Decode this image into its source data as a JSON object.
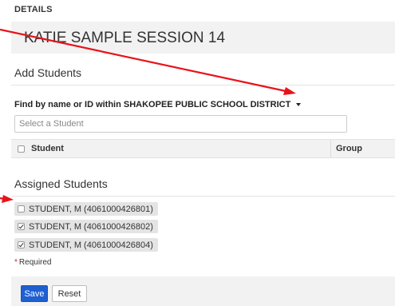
{
  "details": {
    "label": "DETAILS",
    "session_title": "KATIE SAMPLE SESSION 14"
  },
  "add_students": {
    "heading": "Add Students",
    "find_label": "Find by name or ID within SHAKOPEE PUBLIC SCHOOL DISTRICT",
    "search_placeholder": "Select a Student",
    "table": {
      "columns": [
        "Student",
        "Group"
      ]
    }
  },
  "assigned_students": {
    "heading": "Assigned Students",
    "students": [
      {
        "label": "STUDENT, M (4061000426801)",
        "checked": false
      },
      {
        "label": "STUDENT, M (4061000426802)",
        "checked": true
      },
      {
        "label": "STUDENT, M (4061000426804)",
        "checked": true
      }
    ]
  },
  "form": {
    "required_marker": "*",
    "required_text": "Required",
    "save_label": "Save",
    "reset_label": "Reset"
  },
  "colors": {
    "annotation_arrow": "#e8131a",
    "primary_button": "#1f5fd1",
    "required_star": "#cc2a1f"
  }
}
